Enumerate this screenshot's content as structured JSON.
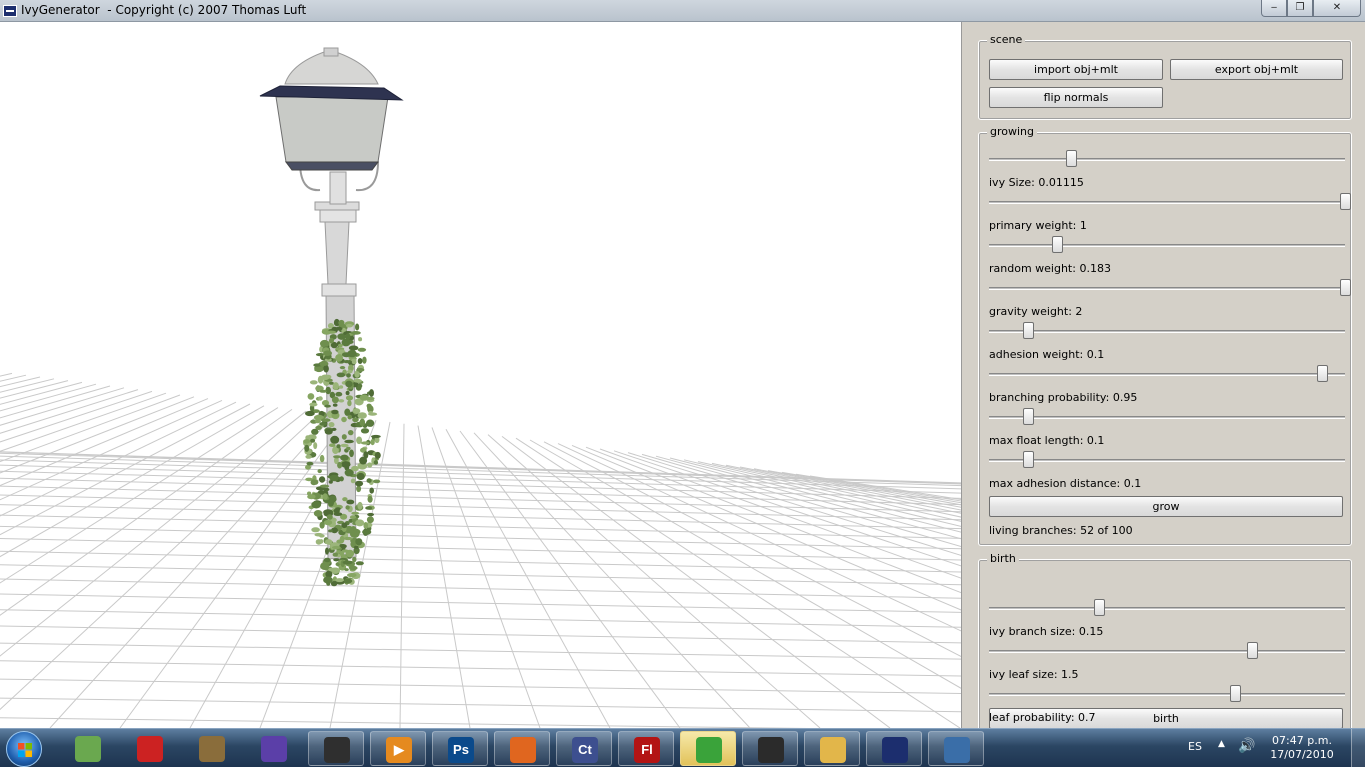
{
  "window": {
    "title": "IvyGenerator  - Copyright (c) 2007 Thomas Luft",
    "minimize": "‒",
    "maximize": "❐",
    "close": "✕"
  },
  "scene": {
    "title": "scene",
    "import_label": "import obj+mlt",
    "export_label": "export obj+mlt",
    "flip_label": "flip normals"
  },
  "growing": {
    "title": "growing",
    "sliders": [
      {
        "label": "ivy Size: 0.01115",
        "position": 0.23
      },
      {
        "label": "primary weight: 1",
        "position": 1.0
      },
      {
        "label": "random weight: 0.183",
        "position": 0.19
      },
      {
        "label": "gravity weight: 2",
        "position": 1.0
      },
      {
        "label": "adhesion weight: 0.1",
        "position": 0.11
      },
      {
        "label": "branching probability: 0.95",
        "position": 0.935
      },
      {
        "label": "max float length: 0.1",
        "position": 0.11
      },
      {
        "label": "max adhesion distance: 0.1",
        "position": 0.11
      }
    ],
    "grow_label": "grow",
    "status": "living branches: 52 of 100"
  },
  "birth": {
    "title": "birth",
    "sliders": [
      {
        "label": "ivy branch size: 0.15",
        "position": 0.31
      },
      {
        "label": "ivy leaf size: 1.5",
        "position": 0.74
      },
      {
        "label": "leaf probability: 0.7",
        "position": 0.69
      }
    ],
    "birth_label": "birth"
  },
  "taskbar": {
    "apps": [
      {
        "name": "sphere-app-icon",
        "glyph": "",
        "color": "#6aa84f"
      },
      {
        "name": "swirl-app-icon",
        "glyph": "",
        "color": "#cc2222"
      },
      {
        "name": "brush-app-icon",
        "glyph": "",
        "color": "#8a6d3b"
      },
      {
        "name": "sparkle-app-icon",
        "glyph": "",
        "color": "#5b3fa8"
      },
      {
        "name": "capture-app-icon",
        "glyph": "",
        "color": "#2f2f2f"
      },
      {
        "name": "media-player-icon",
        "glyph": "▶",
        "color": "#e58a1f"
      },
      {
        "name": "photoshop-icon",
        "glyph": "Ps",
        "color": "#0b4a8b"
      },
      {
        "name": "firefox-icon",
        "glyph": "",
        "color": "#e0661f"
      },
      {
        "name": "captivate-icon",
        "glyph": "Ct",
        "color": "#3d4f8f"
      },
      {
        "name": "flash-icon",
        "glyph": "Fl",
        "color": "#b31414"
      },
      {
        "name": "messenger-icon",
        "glyph": "",
        "color": "#3aa33a"
      },
      {
        "name": "xsi-icon",
        "glyph": "",
        "color": "#2b2b2b"
      },
      {
        "name": "explorer-folder-icon",
        "glyph": "",
        "color": "#e2b64a"
      },
      {
        "name": "ivy-window-icon",
        "glyph": "",
        "color": "#1c2e6e"
      },
      {
        "name": "network-globe-icon",
        "glyph": "",
        "color": "#3a6ea8"
      }
    ],
    "lang": "ES",
    "time": "07:47 p.m.",
    "date": "17/07/2010"
  }
}
